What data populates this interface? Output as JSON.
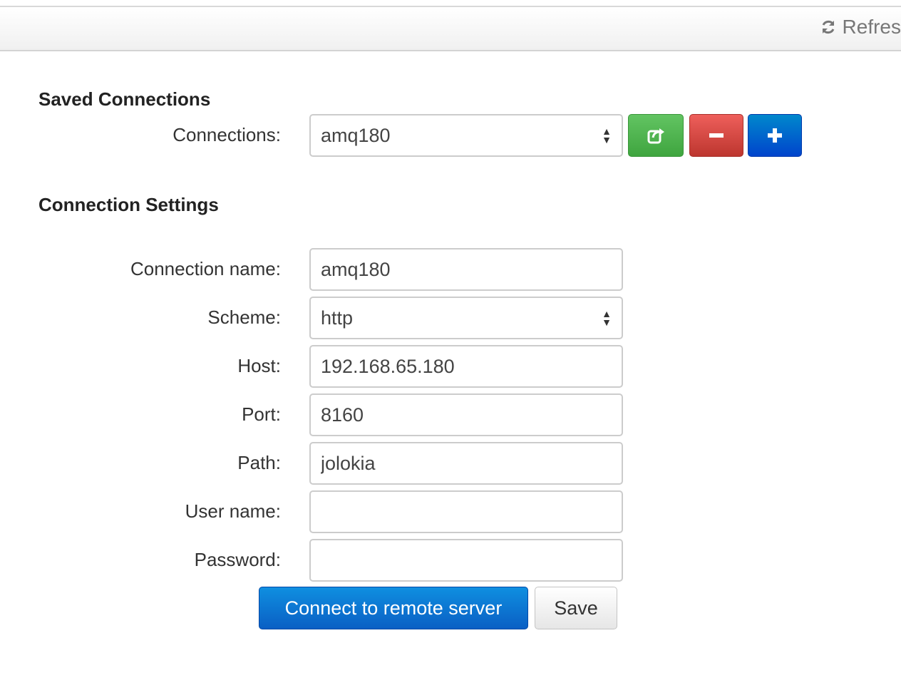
{
  "toolbar": {
    "refresh_label": "Refres",
    "refresh_icon": "refresh-icon"
  },
  "saved_connections": {
    "title": "Saved Connections",
    "connections_label": "Connections:",
    "selected": "amq180",
    "buttons": {
      "connect_icon": "share-icon",
      "delete_icon": "minus-icon",
      "add_icon": "plus-icon",
      "connect_color": "#5bb75b",
      "delete_color": "#da4f49",
      "add_color": "#006dcc"
    }
  },
  "connection_settings": {
    "title": "Connection Settings",
    "fields": {
      "name_label": "Connection name:",
      "name_value": "amq180",
      "scheme_label": "Scheme:",
      "scheme_value": "http",
      "host_label": "Host:",
      "host_value": "192.168.65.180",
      "port_label": "Port:",
      "port_value": "8160",
      "path_label": "Path:",
      "path_value": "jolokia",
      "username_label": "User name:",
      "username_value": "",
      "password_label": "Password:",
      "password_value": ""
    },
    "connect_label": "Connect to remote server",
    "save_label": "Save"
  }
}
